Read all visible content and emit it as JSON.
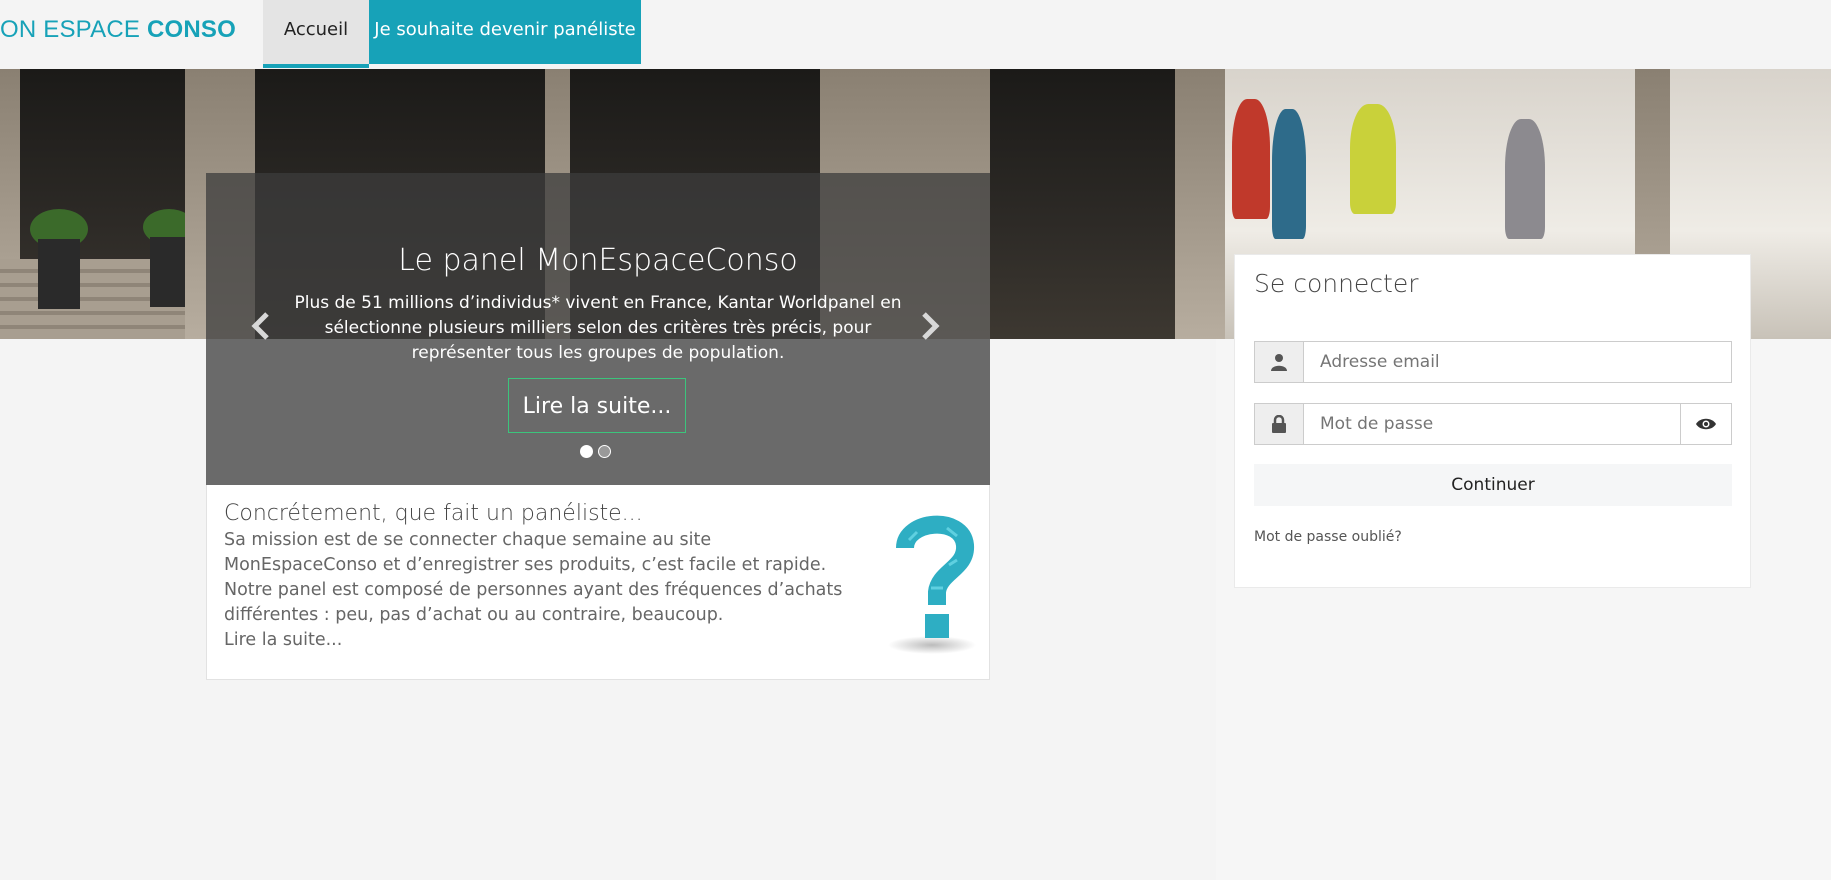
{
  "header": {
    "brand_light": "ON ESPACE ",
    "brand_bold": "CONSO",
    "nav": [
      {
        "label": "Accueil",
        "active": true
      },
      {
        "label": "Je souhaite devenir panéliste",
        "active": false
      }
    ]
  },
  "carousel": {
    "title": "Le panel MonEspaceConso",
    "text": "Plus de 51 millions d’individus* vivent en France, Kantar Worldpanel en sélectionne plusieurs milliers selon des critères très précis, pour représenter tous les groupes de population.",
    "button_label": "Lire la suite...",
    "slide_count": 2,
    "active_slide": 1
  },
  "info": {
    "title": "Concrétement, que fait un panéliste...",
    "text": "Sa mission est de se connecter chaque semaine au site MonEspaceConso et d’enregistrer ses produits, c’est facile et rapide. Notre panel est composé de personnes ayant des fréquences d’achats différentes : peu, pas d’achat ou au contraire, beaucoup.",
    "more_label": "Lire la suite..."
  },
  "login": {
    "title": "Se connecter",
    "email_placeholder": "Adresse email",
    "password_placeholder": "Mot de passe",
    "continue_label": "Continuer",
    "forgot_label": "Mot de passe oublié?"
  },
  "colors": {
    "accent": "#17a2b8",
    "button_border": "#3cc47c"
  },
  "icons": {
    "email_addon": "user-icon",
    "password_addon": "lock-icon",
    "password_toggle": "eye-icon"
  }
}
